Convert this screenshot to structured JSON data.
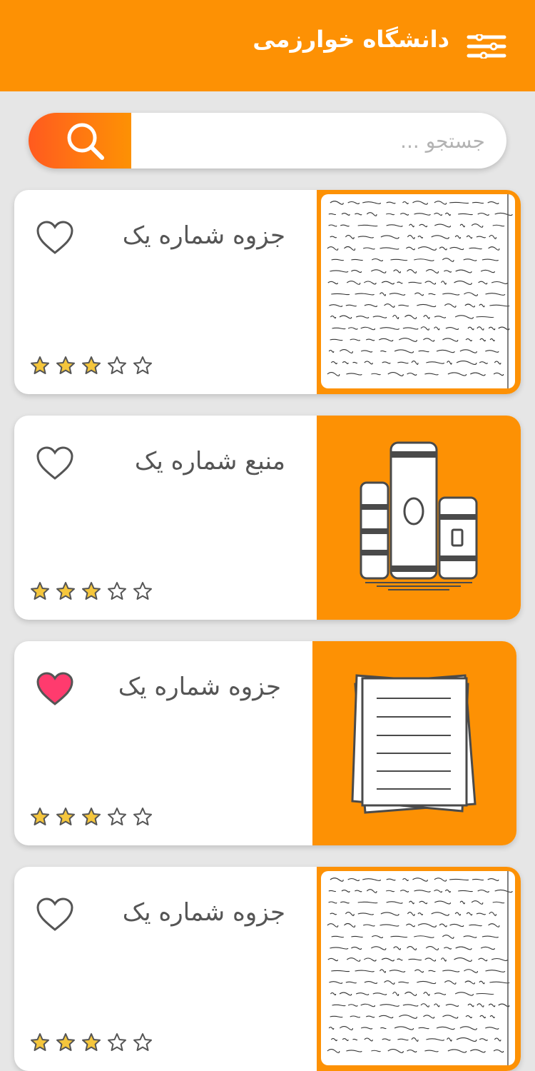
{
  "app": {
    "title": "دانشگاه خوارزمی",
    "accent_color": "#fd9104",
    "menu_icon": "filter-menu-icon"
  },
  "search": {
    "placeholder": "جستجو ...",
    "value": "",
    "icon": "search-icon"
  },
  "items": [
    {
      "title": "جزوه شماره یک",
      "favorite": false,
      "rating": 3,
      "max_rating": 5,
      "thumbnail": "handwritten-notes-image"
    },
    {
      "title": "منبع شماره یک",
      "favorite": false,
      "rating": 3,
      "max_rating": 5,
      "thumbnail": "books-icon"
    },
    {
      "title": "جزوه شماره یک",
      "favorite": true,
      "rating": 3,
      "max_rating": 5,
      "thumbnail": "paper-stack-icon"
    },
    {
      "title": "جزوه شماره یک",
      "favorite": false,
      "rating": 3,
      "max_rating": 5,
      "thumbnail": "handwritten-notes-image"
    }
  ],
  "colors": {
    "star_filled": "#f5c63c",
    "heart_filled": "#ff3b6e",
    "icon_gray": "#555555"
  }
}
